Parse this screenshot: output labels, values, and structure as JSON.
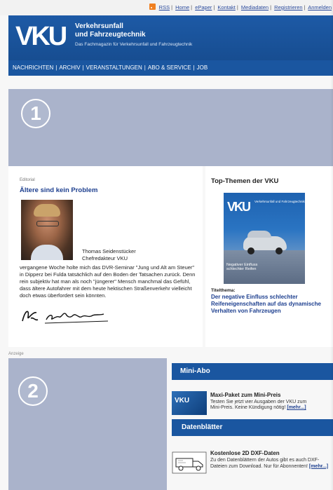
{
  "toplinks": [
    "RSS",
    "Home",
    "ePaper",
    "Kontakt",
    "Mediadaten",
    "Registrieren",
    "Anmelden"
  ],
  "header": {
    "logo": "VKU",
    "title_line1": "Verkehrsunfall",
    "title_line2": "und Fahrzeugtechnik",
    "subtitle": "Das Fachmagazin für Verkehrsunfall und Fahrzeugtechnik"
  },
  "nav": [
    "NACHRICHTEN",
    "ARCHIV",
    "VERANSTALTUNGEN",
    "ABO & SERVICE",
    "JOB"
  ],
  "slots": {
    "slot1": "1",
    "slot2": "2"
  },
  "editorial": {
    "category": "Editorial",
    "title": "Ältere sind kein Problem",
    "author_name": "Thomas Seidenstücker",
    "author_role": "Chefredakteur VKU",
    "body": "vergangene Woche holte mich das DVR-Seminar \"Jung und Alt am Steuer\" in Dipperz bei Fulda tatsächlich auf den Boden der Tatsachen zurück. Denn rein subjektiv hat man als noch \"jüngerer\" Mensch manchmal das Gefühl, dass ältere Autofahrer mit dem heute hektischen Straßenverkehr vielleicht doch etwas überfordert sein könnten."
  },
  "topthemen": {
    "heading": "Top-Themen der VKU",
    "cover_logo": "VKU",
    "cover_title": "Verkehrsunfall und Fahrzeugtechnik",
    "cover_text": "Negativer Einfluss schlechter Reifen",
    "label": "Titelthema:",
    "link": "Der negative Einfluss schlechter Reifeneigenschaften auf das dynamische Verhalten von Fahrzeugen"
  },
  "lower": {
    "anzeige": "Anzeige",
    "miniabo": "Mini-Abo",
    "ma_title": "Maxi-Paket zum Mini-Preis",
    "ma_text1": "Testen Sie jetzt vier Ausgaben der VKU zum",
    "ma_text2": "Mini-Preis. Keine Kündigung nötig!",
    "ma_more": "[mehr...]",
    "datenblaetter": "Datenblätter",
    "dx_title": "Kostenlose 2D DXF-Daten",
    "dx_text": "Zu den Datenblättern der Autos gibt es auch DXF-Dateien zum Download. Nur für Abonnenten!",
    "dx_more": "[mehr...]"
  }
}
